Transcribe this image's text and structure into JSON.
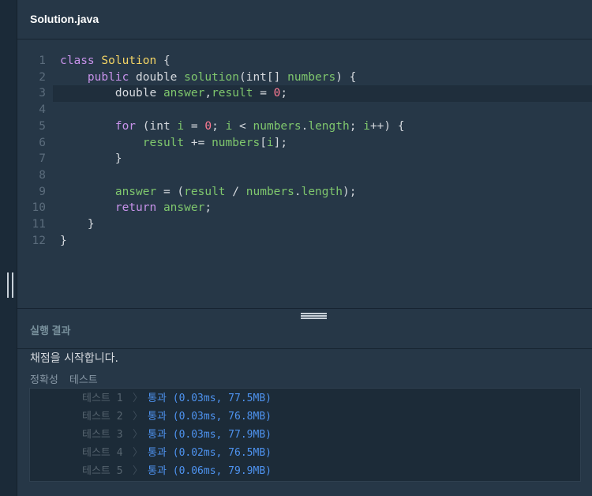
{
  "tab": {
    "title": "Solution.java"
  },
  "editor": {
    "lines": [
      {
        "n": "1",
        "tokens": [
          [
            "kw",
            "class "
          ],
          [
            "cls",
            "Solution"
          ],
          [
            "plain",
            " {"
          ]
        ]
      },
      {
        "n": "2",
        "tokens": [
          [
            "plain",
            "    "
          ],
          [
            "kw",
            "public "
          ],
          [
            "plain",
            "double "
          ],
          [
            "var",
            "solution"
          ],
          [
            "plain",
            "(int[] "
          ],
          [
            "var",
            "numbers"
          ],
          [
            "plain",
            ") {"
          ]
        ]
      },
      {
        "n": "3",
        "tokens": [
          [
            "plain",
            "        double "
          ],
          [
            "var",
            "answer"
          ],
          [
            "plain",
            ","
          ],
          [
            "var",
            "result"
          ],
          [
            "plain",
            " = "
          ],
          [
            "num",
            "0"
          ],
          [
            "plain",
            ";"
          ]
        ],
        "active": true
      },
      {
        "n": "4",
        "tokens": []
      },
      {
        "n": "5",
        "tokens": [
          [
            "plain",
            "        "
          ],
          [
            "kw",
            "for "
          ],
          [
            "plain",
            "(int "
          ],
          [
            "var",
            "i"
          ],
          [
            "plain",
            " = "
          ],
          [
            "num",
            "0"
          ],
          [
            "plain",
            "; "
          ],
          [
            "var",
            "i"
          ],
          [
            "plain",
            " < "
          ],
          [
            "var",
            "numbers"
          ],
          [
            "plain",
            "."
          ],
          [
            "var",
            "length"
          ],
          [
            "plain",
            "; "
          ],
          [
            "var",
            "i"
          ],
          [
            "plain",
            "++) {"
          ]
        ]
      },
      {
        "n": "6",
        "tokens": [
          [
            "plain",
            "            "
          ],
          [
            "var",
            "result"
          ],
          [
            "plain",
            " += "
          ],
          [
            "var",
            "numbers"
          ],
          [
            "plain",
            "["
          ],
          [
            "var",
            "i"
          ],
          [
            "plain",
            "];"
          ]
        ]
      },
      {
        "n": "7",
        "tokens": [
          [
            "plain",
            "        }"
          ]
        ]
      },
      {
        "n": "8",
        "tokens": []
      },
      {
        "n": "9",
        "tokens": [
          [
            "plain",
            "        "
          ],
          [
            "var",
            "answer"
          ],
          [
            "plain",
            " = ("
          ],
          [
            "var",
            "result"
          ],
          [
            "plain",
            " / "
          ],
          [
            "var",
            "numbers"
          ],
          [
            "plain",
            "."
          ],
          [
            "var",
            "length"
          ],
          [
            "plain",
            ");"
          ]
        ]
      },
      {
        "n": "10",
        "tokens": [
          [
            "plain",
            "        "
          ],
          [
            "kw",
            "return "
          ],
          [
            "var",
            "answer"
          ],
          [
            "plain",
            ";"
          ]
        ]
      },
      {
        "n": "11",
        "tokens": [
          [
            "plain",
            "    }"
          ]
        ]
      },
      {
        "n": "12",
        "tokens": [
          [
            "plain",
            "}"
          ]
        ]
      }
    ]
  },
  "result": {
    "title": "실행 결과",
    "message": "채점을 시작합니다.",
    "section": [
      "정확성",
      "테스트"
    ],
    "tests": [
      {
        "name": "테스트 1",
        "chevron": "〉",
        "result": "통과 (0.03ms, 77.5MB)"
      },
      {
        "name": "테스트 2",
        "chevron": "〉",
        "result": "통과 (0.03ms, 76.8MB)"
      },
      {
        "name": "테스트 3",
        "chevron": "〉",
        "result": "통과 (0.03ms, 77.9MB)"
      },
      {
        "name": "테스트 4",
        "chevron": "〉",
        "result": "통과 (0.02ms, 76.5MB)"
      },
      {
        "name": "테스트 5",
        "chevron": "〉",
        "result": "통과 (0.06ms, 79.9MB)"
      }
    ]
  },
  "colors": {
    "background": "#263747",
    "keyword": "#c792ea",
    "class_name": "#f3d465",
    "identifier": "#7fc76d",
    "number": "#ff7a93",
    "pass": "#4e93f0"
  }
}
